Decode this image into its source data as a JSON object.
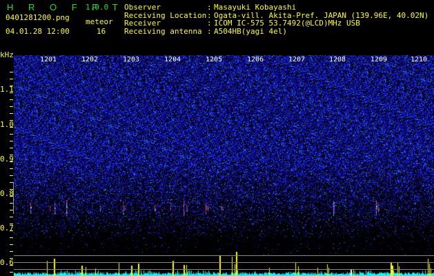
{
  "header": {
    "app_name": "H R O F F T",
    "version": "1.0.0",
    "filename": "0401281200.png",
    "datetime": "04.01.28 12:00",
    "meteor_label": "meteor",
    "meteor_count": "16"
  },
  "info": [
    {
      "key": "Observer",
      "value": "Masayuki Kobayashi"
    },
    {
      "key": "Receiving Location",
      "value": "Ogata-vill. Akita-Pref. JAPAN (139.96E, 40.02N)"
    },
    {
      "key": "Receiver",
      "value": "ICOM IC-575 53.7492(@LCD)MHz USB"
    },
    {
      "key": "Receiving antenna",
      "value": "A504HB(yagi 4el)"
    }
  ],
  "axis": {
    "unit": "kHz",
    "freq_labels": [
      "1.1",
      "1.0",
      "0.9",
      "0.8",
      "0.7",
      "0.6"
    ],
    "time_labels": [
      "1201",
      "1202",
      "1203",
      "1204",
      "1205",
      "1206",
      "1207",
      "1208",
      "1209",
      "1210"
    ]
  },
  "colors": {
    "text": "#ffff00",
    "logo": "#22dd22",
    "noise": "#1a1aff",
    "echo_bar": "#ffff00",
    "baseline": "#00ffff"
  }
}
